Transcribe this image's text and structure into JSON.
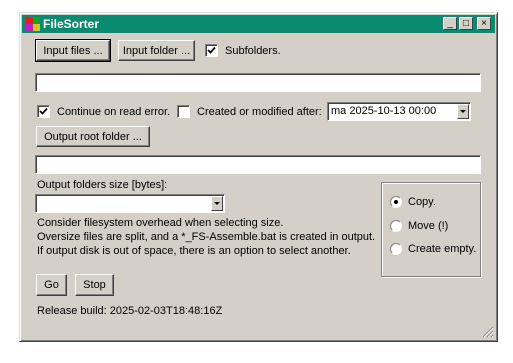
{
  "window": {
    "title": "FileSorter",
    "minimize": "_",
    "maximize": "□",
    "close": "×"
  },
  "buttons": {
    "input_files": "Input files ...",
    "input_folder": "Input folder ...",
    "output_root": "Output root folder ...",
    "go": "Go",
    "stop": "Stop"
  },
  "options": {
    "subfolders": {
      "label": "Subfolders.",
      "checked": true
    },
    "continue_on_error": {
      "label": "Continue on read error.",
      "checked": true
    },
    "created_or_modified": {
      "label": "Created or modified after:",
      "checked": false
    },
    "date_value": "ma 2025-10-13 00:00"
  },
  "fields": {
    "input_path": "",
    "output_path": ""
  },
  "size": {
    "label": "Output folders size [bytes]:",
    "value": ""
  },
  "info": {
    "line1": "Consider filesystem overhead when selecting size.",
    "line2": "Oversize files are split, and a *_FS-Assemble.bat is created in output.",
    "line3": "If output disk is out of space, there is an option to select another."
  },
  "mode": {
    "copy": "Copy.",
    "move": "Move (!)",
    "create_empty": "Create empty.",
    "selected": "copy"
  },
  "build": "Release build: 2025-02-03T18:48:16Z",
  "icon_names": [
    "app-icon",
    "check-icon",
    "dropdown-arrow-icon",
    "resize-grip-icon"
  ]
}
